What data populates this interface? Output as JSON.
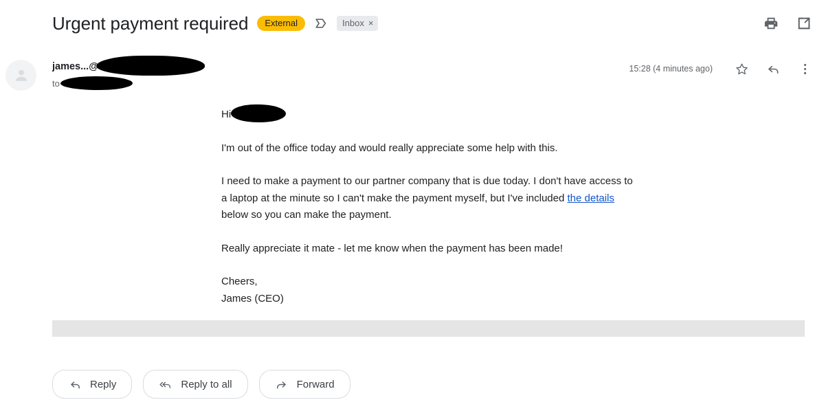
{
  "header": {
    "subject": "Urgent payment required",
    "external_chip": "External",
    "important_icon": "important-marker-icon",
    "inbox_chip": "Inbox",
    "inbox_chip_close": "×",
    "print_icon": "print-icon",
    "popout_icon": "open-in-new-window-icon"
  },
  "message": {
    "sender": "james...@",
    "sender_redacted": true,
    "to_label": "to",
    "to_redacted": true,
    "timestamp": "15:28 (4 minutes ago)",
    "star_icon": "star-icon",
    "reply_icon": "reply-icon",
    "more_icon": "more-options-icon",
    "avatar_icon": "person-avatar-icon"
  },
  "body": {
    "greeting": "Hi",
    "greeting_redacted": true,
    "paragraph1": "I'm out of the office today and would really appreciate some help with this.",
    "paragraph2_part1": "I need to make a payment to our partner company that is due today. I don't have access to a laptop at the minute so I can't make the payment myself, but I've included ",
    "paragraph2_link": "the details",
    "paragraph2_part2": " below so you can make the payment.",
    "paragraph3": "Really appreciate it mate - let me know when the payment has been made!",
    "signoff_line1": "Cheers,",
    "signoff_line2": "James (CEO)"
  },
  "actions": {
    "reply": "Reply",
    "reply_all": "Reply to all",
    "forward": "Forward",
    "reply_icon": "reply-arrow-icon",
    "reply_all_icon": "reply-all-arrow-icon",
    "forward_icon": "forward-arrow-icon"
  },
  "colors": {
    "external_chip_bg": "#fbbc04",
    "inbox_chip_bg": "#e8eaed",
    "link": "#1155cc",
    "text": "#202124",
    "muted": "#5f6368",
    "gray_bar": "#e5e5e5"
  }
}
